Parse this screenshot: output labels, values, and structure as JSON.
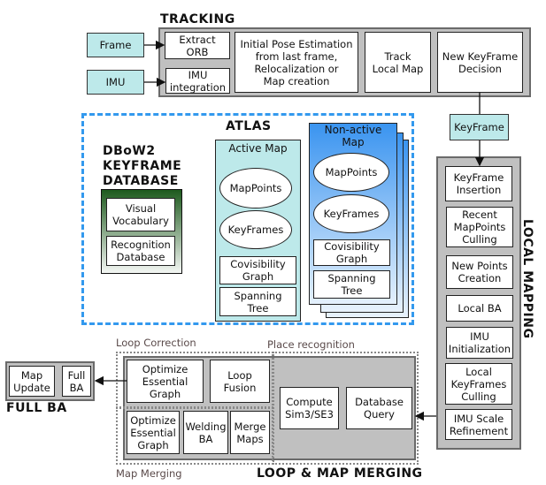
{
  "tracking": {
    "title": "TRACKING",
    "inputs": {
      "frame": "Frame",
      "imu": "IMU"
    },
    "extract_orb": "Extract\nORB",
    "imu_integration": "IMU\nintegration",
    "initial_pose": "Initial Pose Estimation\nfrom last frame,\nRelocalization or\nMap creation",
    "track_local_map": "Track\nLocal Map",
    "new_keyframe_decision": "New KeyFrame\nDecision"
  },
  "keyframe_node": "KeyFrame",
  "atlas": {
    "title": "ATLAS",
    "dbow2": {
      "title": "DBoW2\nKEYFRAME\nDATABASE",
      "visual_vocabulary": "Visual\nVocabulary",
      "recognition_database": "Recognition\nDatabase"
    },
    "active_map": {
      "title": "Active Map",
      "mappoints": "MapPoints",
      "keyframes": "KeyFrames",
      "covisibility_graph": "Covisibility\nGraph",
      "spanning_tree": "Spanning\nTree"
    },
    "non_active_map": {
      "title": "Non-active\nMap",
      "mappoints": "MapPoints",
      "keyframes": "KeyFrames",
      "covisibility_graph": "Covisibility\nGraph",
      "spanning_tree": "Spanning\nTree"
    }
  },
  "local_mapping": {
    "title": "LOCAL MAPPING",
    "steps": [
      "KeyFrame\nInsertion",
      "Recent\nMapPoints\nCulling",
      "New Points\nCreation",
      "Local BA",
      "IMU\nInitialization",
      "Local\nKeyFrames\nCulling",
      "IMU Scale\nRefinement"
    ]
  },
  "loop_map_merging": {
    "title": "LOOP & MAP MERGING",
    "loop_correction": {
      "label": "Loop Correction",
      "optimize_essential_graph": "Optimize\nEssential\nGraph",
      "loop_fusion": "Loop\nFusion"
    },
    "map_merging": {
      "label": "Map Merging",
      "optimize_essential_graph": "Optimize\nEssential\nGraph",
      "welding_ba": "Welding\nBA",
      "merge_maps": "Merge\nMaps"
    },
    "place_recognition": {
      "label": "Place recognition",
      "compute_sim3": "Compute\nSim3/SE3",
      "database_query": "Database\nQuery"
    }
  },
  "full_ba": {
    "title": "FULL BA",
    "map_update": "Map\nUpdate",
    "full_ba_box": "Full\nBA"
  },
  "colors": {
    "input_fill": "#bde9ea",
    "module_gray": "#c0c0c0",
    "atlas_border": "#3399ee",
    "dbow2_gradient_top": "#1e5a1e",
    "nonactive_gradient_top": "#3a94f0"
  }
}
